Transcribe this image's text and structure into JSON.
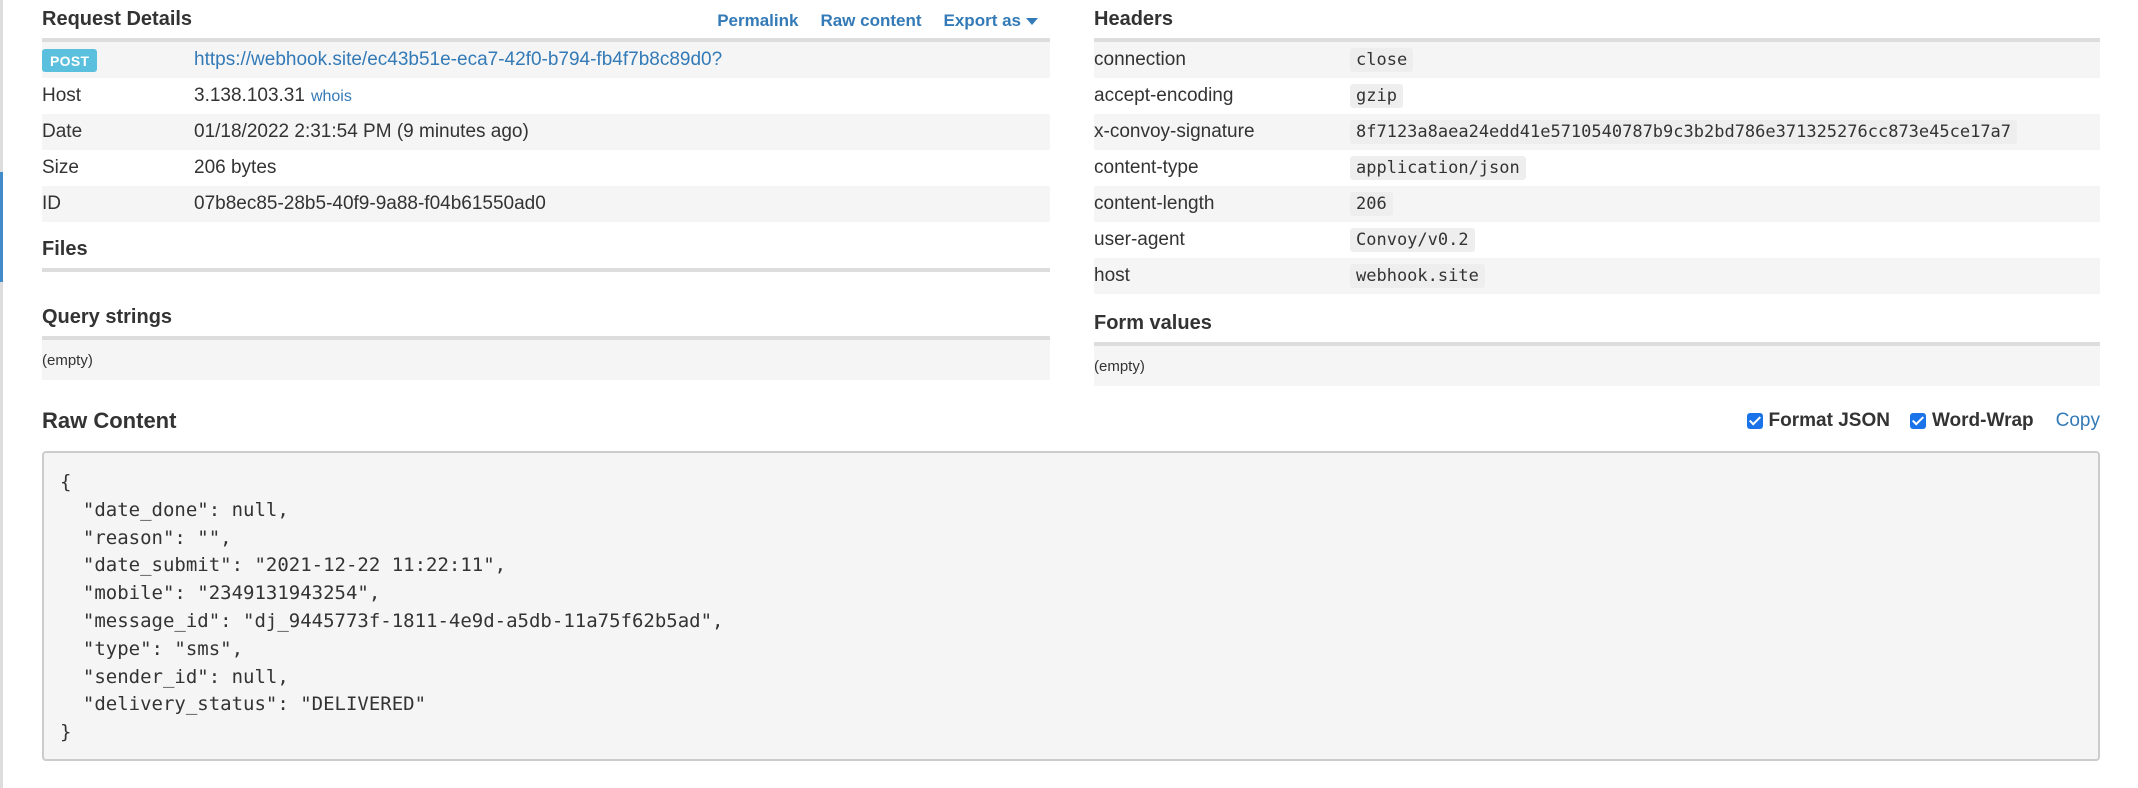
{
  "request_details": {
    "title": "Request Details",
    "actions": {
      "permalink": "Permalink",
      "raw_content": "Raw content",
      "export_as": "Export as"
    },
    "method": "POST",
    "url": "https://webhook.site/ec43b51e-eca7-42f0-b794-fb4f7b8c89d0?",
    "rows": [
      {
        "key": "Host",
        "value": "3.138.103.31",
        "extra": "whois"
      },
      {
        "key": "Date",
        "value": "01/18/2022 2:31:54 PM (9 minutes ago)"
      },
      {
        "key": "Size",
        "value": "206 bytes"
      },
      {
        "key": "ID",
        "value": "07b8ec85-28b5-40f9-9a88-f04b61550ad0"
      }
    ]
  },
  "files": {
    "title": "Files"
  },
  "query_strings": {
    "title": "Query strings",
    "empty": "(empty)"
  },
  "headers": {
    "title": "Headers",
    "rows": [
      {
        "key": "connection",
        "value": "close"
      },
      {
        "key": "accept-encoding",
        "value": "gzip"
      },
      {
        "key": "x-convoy-signature",
        "value": "8f7123a8aea24edd41e5710540787b9c3b2bd786e371325276cc873e45ce17a7"
      },
      {
        "key": "content-type",
        "value": "application/json"
      },
      {
        "key": "content-length",
        "value": "206"
      },
      {
        "key": "user-agent",
        "value": "Convoy/v0.2"
      },
      {
        "key": "host",
        "value": "webhook.site"
      }
    ]
  },
  "form_values": {
    "title": "Form values",
    "empty": "(empty)"
  },
  "raw_content": {
    "title": "Raw Content",
    "format_json_label": "Format JSON",
    "format_json_checked": true,
    "word_wrap_label": "Word-Wrap",
    "word_wrap_checked": true,
    "copy_label": "Copy",
    "body": "{\n  \"date_done\": null,\n  \"reason\": \"\",\n  \"date_submit\": \"2021-12-22 11:22:11\",\n  \"mobile\": \"2349131943254\",\n  \"message_id\": \"dj_9445773f-1811-4e9d-a5db-11a75f62b5ad\",\n  \"type\": \"sms\",\n  \"sender_id\": null,\n  \"delivery_status\": \"DELIVERED\"\n}"
  },
  "colors": {
    "link": "#337ab7",
    "badge_post": "#5bc0de",
    "stripe": "#f5f5f5",
    "checkbox": "#1a73e8"
  }
}
